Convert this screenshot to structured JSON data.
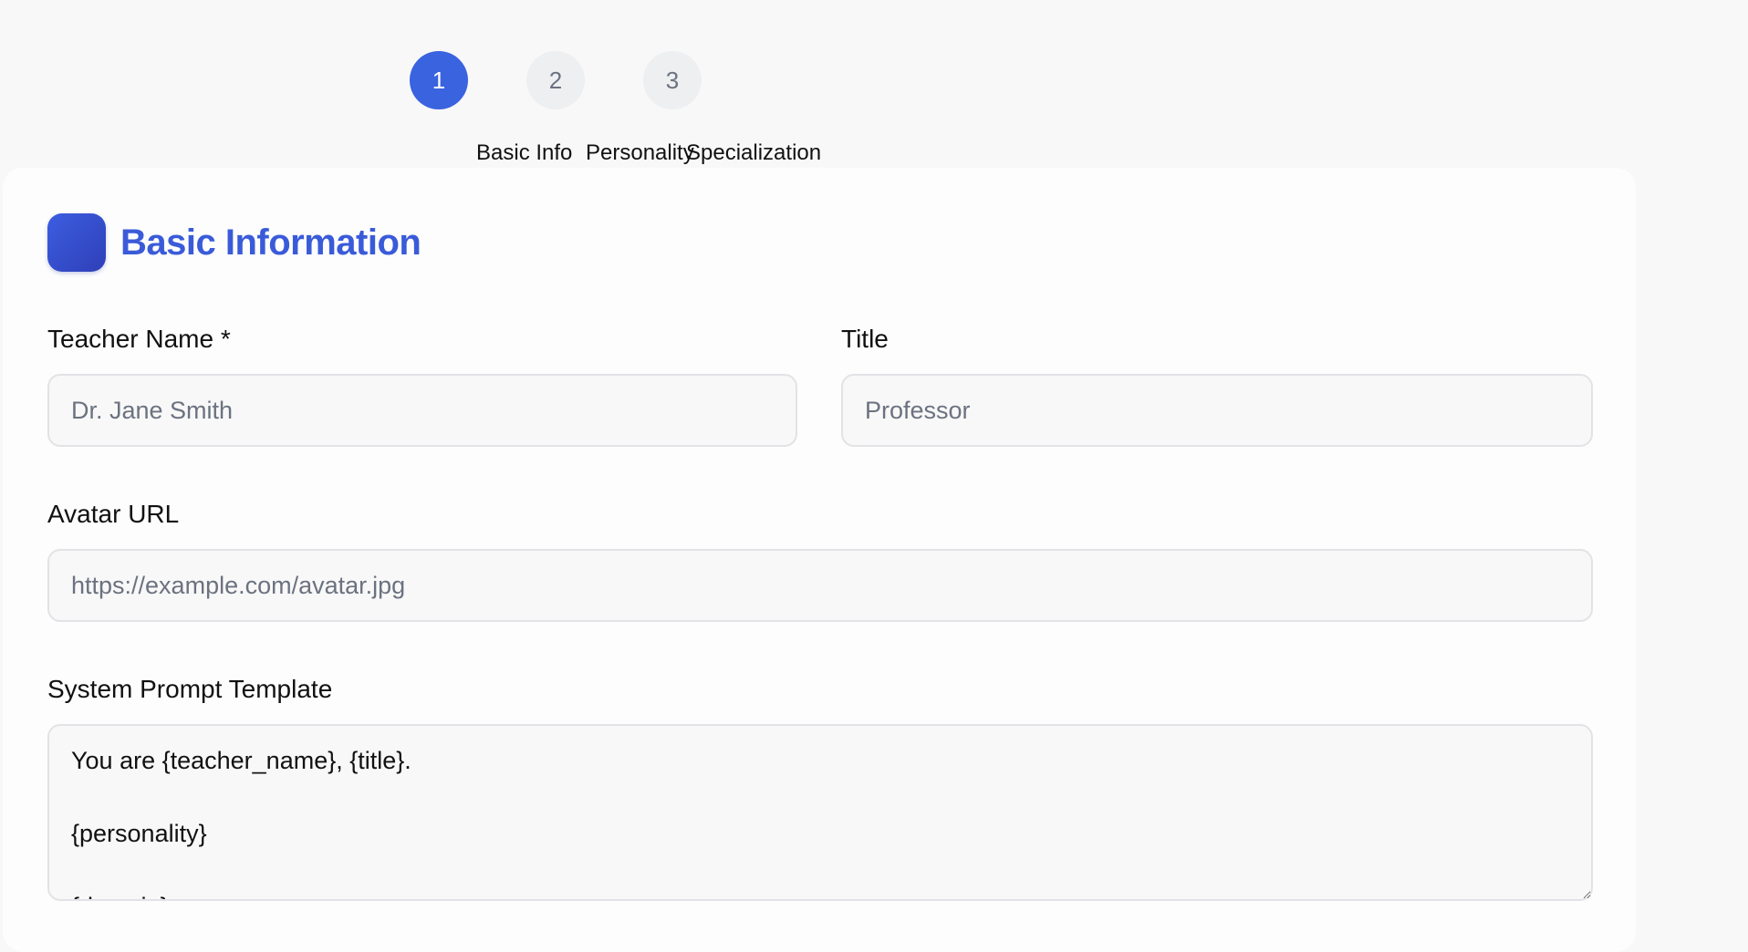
{
  "stepper": {
    "steps": [
      {
        "number": "1",
        "label": "Basic Info",
        "active": true
      },
      {
        "number": "2",
        "label": "Personality",
        "active": false
      },
      {
        "number": "3",
        "label": "Specialization",
        "active": false
      }
    ]
  },
  "section": {
    "title": "Basic Information"
  },
  "form": {
    "teacher_name": {
      "label": "Teacher Name *",
      "placeholder": "Dr. Jane Smith",
      "value": ""
    },
    "title": {
      "label": "Title",
      "placeholder": "Professor",
      "value": ""
    },
    "avatar_url": {
      "label": "Avatar URL",
      "placeholder": "https://example.com/avatar.jpg",
      "value": ""
    },
    "system_prompt": {
      "label": "System Prompt Template",
      "value": "You are {teacher_name}, {title}.\n\n{personality}\n\n{domain}"
    }
  },
  "colors": {
    "accent": "#3a63e0",
    "title_color": "#3a5bd9",
    "inactive_step_bg": "#eeeff1"
  }
}
